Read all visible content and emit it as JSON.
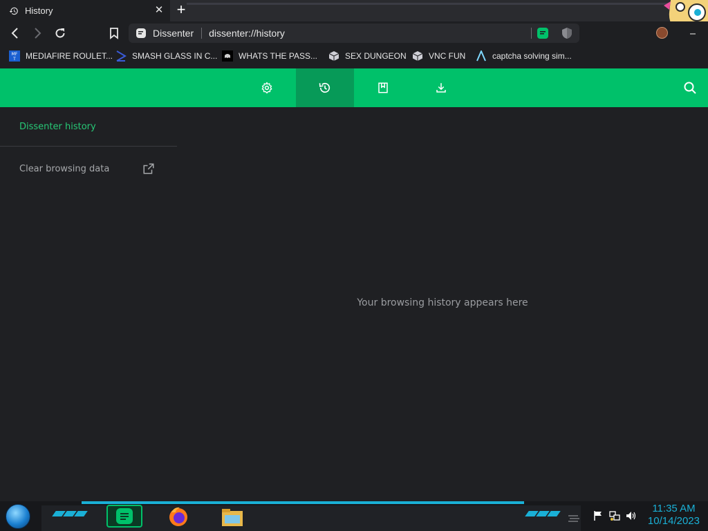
{
  "tab": {
    "title": "History",
    "close_glyph": "✕",
    "new_tab_glyph": "+"
  },
  "omnibox": {
    "site_name": "Dissenter",
    "url": "dissenter://history"
  },
  "bookmarks": [
    {
      "label": "MEDIAFIRE ROULET...",
      "icon": "mediafire-icon"
    },
    {
      "label": "SMASH GLASS IN C...",
      "icon": "smash-glass-icon"
    },
    {
      "label": "WHATS THE PASS...",
      "icon": "ghost-icon"
    },
    {
      "label": "SEX DUNGEON",
      "icon": "cube-icon"
    },
    {
      "label": "VNC FUN",
      "icon": "cube-icon"
    },
    {
      "label": "captcha solving sim...",
      "icon": "a-logo-icon"
    }
  ],
  "appbar": {
    "buttons": [
      {
        "name": "settings",
        "icon": "gear-icon",
        "active": false
      },
      {
        "name": "history",
        "icon": "history-icon",
        "active": true
      },
      {
        "name": "bookmarks",
        "icon": "bookmark-icon",
        "active": false
      },
      {
        "name": "downloads",
        "icon": "download-icon",
        "active": false
      }
    ],
    "search_icon": "search-icon"
  },
  "sidebar": {
    "title": "Dissenter history",
    "clear_label": "Clear browsing data"
  },
  "main": {
    "empty_message": "Your browsing history appears here"
  },
  "taskbar": {
    "time": "11:35 AM",
    "date": "10/14/2023"
  },
  "colors": {
    "accent": "#00c16a",
    "accent_dark": "#079a58",
    "background": "#1f2023",
    "taskbar_cyan": "#1ab0d6"
  }
}
